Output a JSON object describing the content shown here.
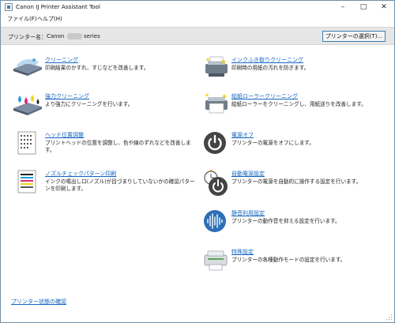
{
  "window": {
    "title": "Canon IJ Printer Assistant Tool"
  },
  "menu": {
    "file": "ファイル(F)",
    "help": "ヘルプ(H)"
  },
  "printer": {
    "label": "プリンター名：",
    "name_prefix": "Canon",
    "name_suffix": "series",
    "select_button": "プリンターの選択(T)..."
  },
  "left_items": [
    {
      "title": "クリーニング",
      "desc": "印刷結果のかすれ、すじなどを改善します。",
      "icon": "printhead-cleaning-icon"
    },
    {
      "title": "強力クリーニング",
      "desc": "より強力にクリーニングを行います。",
      "icon": "deep-cleaning-icon"
    },
    {
      "title": "ヘッド位置調整",
      "desc": "プリントヘッドの位置を調整し、色や線のずれなどを改善します。",
      "icon": "head-alignment-icon"
    },
    {
      "title": "ノズルチェックパターン印刷",
      "desc": "インクの噴出し口(ノズル)が目づまりしていないかの確認パターンを印刷します。",
      "icon": "nozzle-check-icon"
    }
  ],
  "right_items": [
    {
      "title": "インクふき取りクリーニング",
      "desc": "印刷時の用紙の汚れを防ぎます。",
      "icon": "bottom-plate-cleaning-icon"
    },
    {
      "title": "給紙ローラークリーニング",
      "desc": "給紙ローラーをクリーニングし、用紙送りを改善します。",
      "icon": "roller-cleaning-icon"
    },
    {
      "title": "電源オフ",
      "desc": "プリンターの電源をオフにします。",
      "icon": "power-off-icon"
    },
    {
      "title": "自動電源設定",
      "desc": "プリンターの電源を自動的に操作する設定を行います。",
      "icon": "auto-power-icon"
    },
    {
      "title": "静音利用設定",
      "desc": "プリンターの動作音を抑える設定を行います。",
      "icon": "quiet-mode-icon"
    },
    {
      "title": "特殊設定",
      "desc": "プリンターの各種動作モードの設定を行います。",
      "icon": "custom-settings-icon"
    }
  ],
  "footer": {
    "status_link": "プリンター状態の確認"
  }
}
